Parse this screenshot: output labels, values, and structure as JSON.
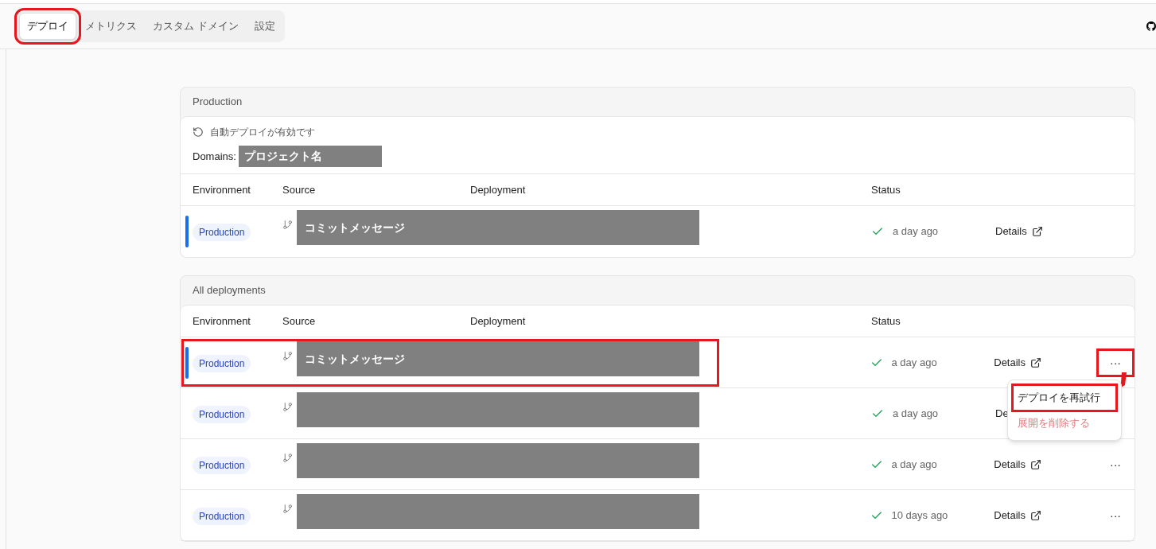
{
  "tabs": [
    {
      "label": "デプロイ",
      "selected": true,
      "highlighted": true
    },
    {
      "label": "メトリクス",
      "selected": false,
      "highlighted": false
    },
    {
      "label": "カスタム ドメイン",
      "selected": false,
      "highlighted": false
    },
    {
      "label": "設定",
      "selected": false,
      "highlighted": false
    }
  ],
  "production": {
    "title": "Production",
    "auto_deploy": "自動デプロイが有効です",
    "domains_label": "Domains:",
    "domain": "プロジェクト名",
    "columns": [
      "Environment",
      "Source",
      "Deployment",
      "Status"
    ],
    "rows": [
      {
        "environment": "Production",
        "current": true,
        "message": "コミットメッセージ",
        "status": "a day ago",
        "details": "Details",
        "link_icon": true,
        "highlighted": false
      }
    ]
  },
  "all_deployments": {
    "title": "All deployments",
    "columns": [
      "Environment",
      "Source",
      "Deployment",
      "Status"
    ],
    "rows": [
      {
        "environment": "Production",
        "current": true,
        "message": "コミットメッセージ",
        "status": "a day ago",
        "details": "Details",
        "link_icon": true,
        "more": "···",
        "menu_open": true,
        "highlighted": true
      },
      {
        "environment": "Production",
        "current": false,
        "status": "a day ago",
        "details": "De",
        "link_icon": false,
        "highlighted": false
      },
      {
        "environment": "Production",
        "current": false,
        "status": "a day ago",
        "details": "Details",
        "link_icon": true,
        "more": "···",
        "menu_open": false,
        "highlighted": false
      },
      {
        "environment": "Production",
        "current": false,
        "status": "10 days ago",
        "details": "Details",
        "link_icon": true,
        "more": "···",
        "menu_open": false,
        "highlighted": false
      }
    ]
  },
  "menu": {
    "items": [
      {
        "label": "デプロイを再試行",
        "kind": "normal",
        "highlighted": true
      },
      {
        "label": "展開を削除する",
        "kind": "danger",
        "highlighted": false
      }
    ]
  }
}
